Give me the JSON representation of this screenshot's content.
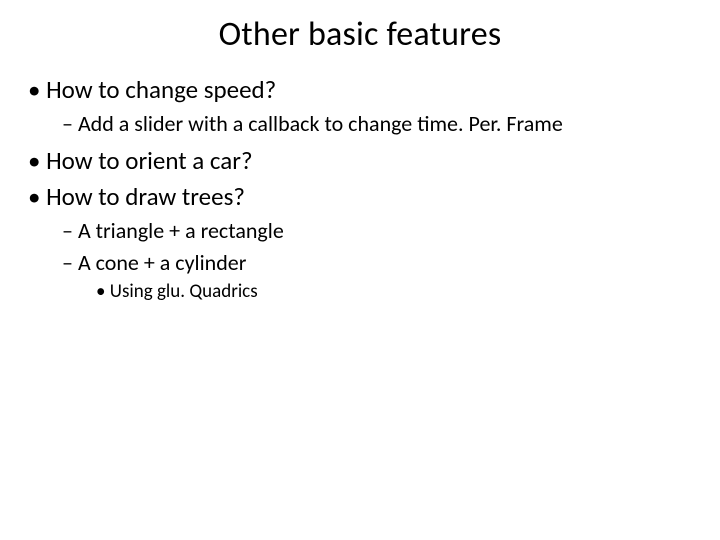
{
  "title": "Other basic features",
  "bullets": {
    "b1": "How to change speed?",
    "b1_1": "Add a slider with a callback to change time. Per. Frame",
    "b2": "How to orient a car?",
    "b3": "How to draw trees?",
    "b3_1": "A triangle + a rectangle",
    "b3_2": "A cone + a cylinder",
    "b3_2_1": "Using glu. Quadrics"
  }
}
